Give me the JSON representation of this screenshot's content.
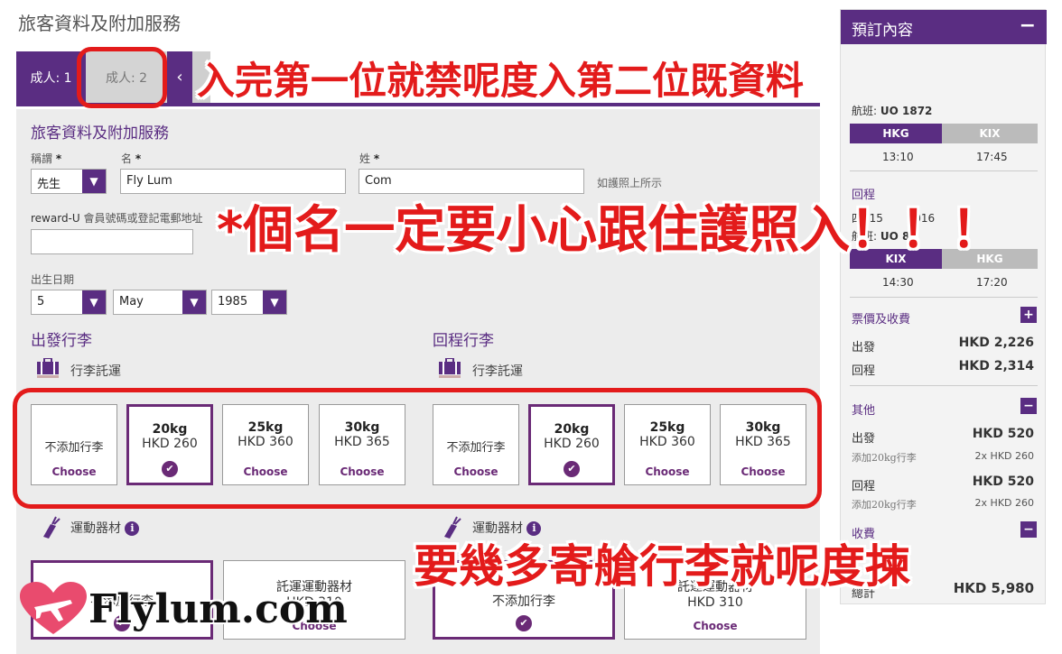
{
  "page": {
    "title": "旅客資料及附加服務"
  },
  "tabs": [
    {
      "label": "成人: 1"
    },
    {
      "label": "成人: 2"
    }
  ],
  "tab_prev_icon": "chevron-left-icon",
  "form": {
    "section_title": "旅客資料及附加服務",
    "title_label": "稱謂",
    "given_label": "名",
    "surname_label": "姓",
    "required_mark": "*",
    "title_value": "先生",
    "given_value": "Fly Lum",
    "surname_value": "Com",
    "passport_hint": "如護照上所示",
    "reward_label_prefix": "reward-U",
    "reward_label_rest": "會員號碼或登記電郵地址",
    "reward_value": "",
    "dob_label": "出生日期",
    "dob_day": "5",
    "dob_month": "May",
    "dob_year": "1985"
  },
  "baggage": {
    "outbound_title": "出發行李",
    "return_title": "回程行李",
    "checked_label": "行李託運",
    "none_label": "不添加行李",
    "choose": "Choose",
    "options": [
      {
        "weight": "20kg",
        "price": "HKD 260"
      },
      {
        "weight": "25kg",
        "price": "HKD 360"
      },
      {
        "weight": "30kg",
        "price": "HKD 365"
      }
    ],
    "selected_index": 0
  },
  "sports": {
    "label": "運動器材",
    "card_title": "託運運動器材",
    "price": "HKD 310",
    "none_label": "不添加行李",
    "choose": "Choose"
  },
  "sidebar": {
    "title": "預訂內容",
    "collapse": "−",
    "flight_label": "航班:",
    "flight_no": "UO 1872",
    "out_from": "HKG",
    "out_to": "KIX",
    "out_dep": "13:10",
    "out_arr": "17:45",
    "return_title": "回程",
    "return_date_partial_a": "四, 15",
    "return_date_partial_b": "2016",
    "return_flight_partial": "UO 87",
    "ret_from": "KIX",
    "ret_to": "HKG",
    "ret_dep": "14:30",
    "ret_arr": "17:20",
    "fares_title": "票價及收費",
    "fare_out_label": "出發",
    "fare_out": "HKD 2,226",
    "fare_ret_label": "回程",
    "fare_ret": "HKD 2,314",
    "other_title": "其他",
    "other_out_label": "出發",
    "other_out": "HKD 520",
    "other_out_sub": "添加20kg行李",
    "other_out_sub_val": "2x HKD 260",
    "other_ret_label": "回程",
    "other_ret": "HKD 520",
    "other_ret_sub": "添加20kg行李",
    "other_ret_sub_val": "2x HKD 260",
    "fees_title_partial": "收費",
    "total_label_partial": "總計",
    "total_partial": "HKD 5,980"
  },
  "annotations": {
    "line1": "入完第一位就禁呢度入第二位既資料",
    "line2": "*個名一定要小心跟住護照入！！！",
    "line3": "要幾多寄艙行李就呢度揀",
    "color": "#e31b1b"
  },
  "watermark": {
    "text": "Flylum.com"
  },
  "colors": {
    "brand": "#5a2d82",
    "selected_border": "#6a2a76"
  }
}
